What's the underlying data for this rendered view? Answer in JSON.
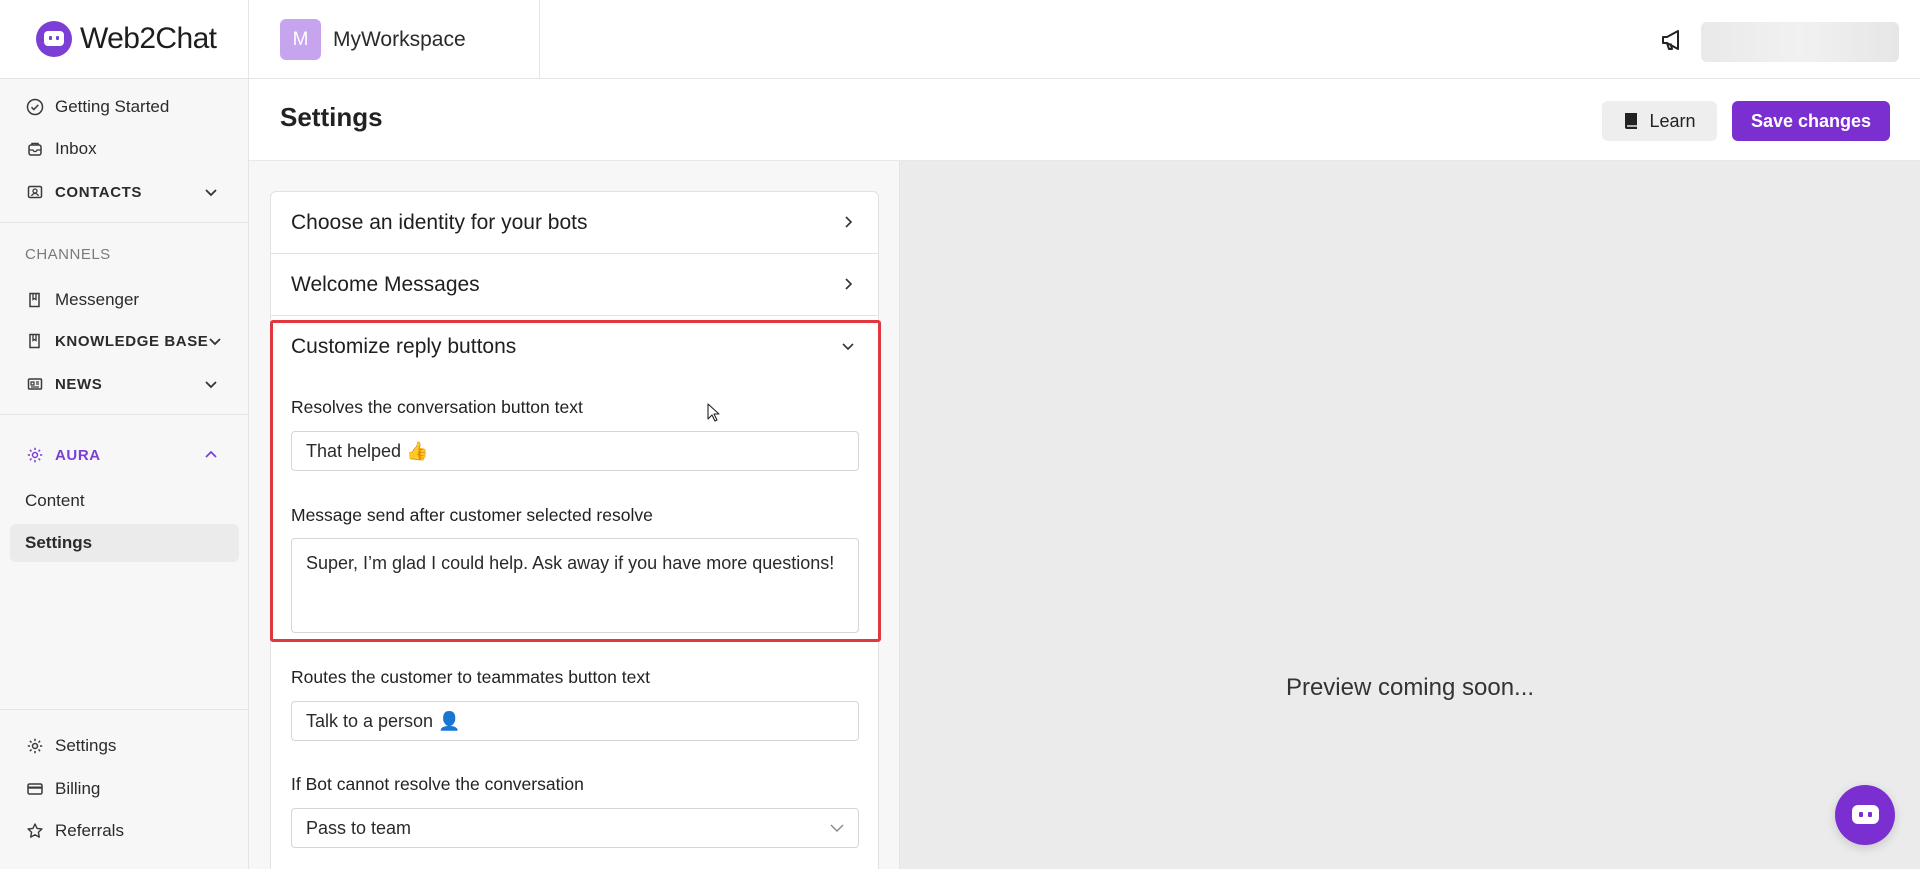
{
  "brand": {
    "name": "Web2Chat"
  },
  "workspace": {
    "avatar_letter": "M",
    "name": "MyWorkspace"
  },
  "sidebar": {
    "items": [
      {
        "label": "Getting Started",
        "icon": "check-circle-icon"
      },
      {
        "label": "Inbox",
        "icon": "inbox-icon"
      },
      {
        "label": "CONTACTS",
        "icon": "contacts-icon",
        "expanded": false
      }
    ],
    "channels_label": "CHANNELS",
    "channels": [
      {
        "label": "Messenger",
        "icon": "messenger-icon"
      },
      {
        "label": "KNOWLEDGE BASE",
        "icon": "book-icon",
        "expanded": false
      },
      {
        "label": "NEWS",
        "icon": "news-icon",
        "expanded": false
      }
    ],
    "aura": {
      "label": "AURA",
      "icon": "gear-icon",
      "expanded": true,
      "children": [
        {
          "label": "Content",
          "active": false
        },
        {
          "label": "Settings",
          "active": true
        }
      ]
    },
    "bottom": [
      {
        "label": "Settings",
        "icon": "gear-icon"
      },
      {
        "label": "Billing",
        "icon": "credit-card-icon"
      },
      {
        "label": "Referrals",
        "icon": "star-icon"
      }
    ]
  },
  "header": {
    "title": "Settings",
    "learn_label": "Learn",
    "save_label": "Save changes"
  },
  "accordion": {
    "identity": "Choose an identity for your bots",
    "welcome": "Welcome Messages",
    "reply_buttons": "Customize reply buttons"
  },
  "form": {
    "resolve_label": "Resolves the conversation button text",
    "resolve_value": "That helped 👍",
    "resolve_message_label": "Message send after customer selected resolve",
    "resolve_message_value": "Super, I’m glad I could help. Ask away if you have more questions!",
    "route_label": "Routes the customer to teammates button text",
    "route_value": "Talk to a person 👤",
    "unresolved_label": "If Bot cannot resolve the conversation",
    "unresolved_value": "Pass to team"
  },
  "preview": {
    "text": "Preview coming soon..."
  },
  "colors": {
    "accent": "#7b2fd0",
    "highlight": "#e0383e"
  }
}
